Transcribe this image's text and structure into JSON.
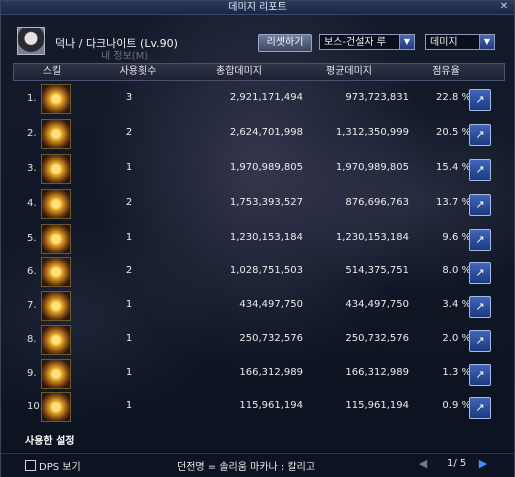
{
  "window": {
    "title": "데미지 리포트",
    "close_glyph": "✕"
  },
  "header": {
    "character": "덕나 / 다크나이트 (Lv.90)",
    "info_bar": "내 정보(M)",
    "reset_label": "리셋하기",
    "boss_select": {
      "value": "보스-건설자 루"
    },
    "type_select": {
      "value": "데미지"
    }
  },
  "columns": [
    "스킬",
    "사용횟수",
    "총합데미지",
    "평균데미지",
    "점유율"
  ],
  "rows": [
    {
      "rank": "1.",
      "count": "3",
      "total": "2,921,171,494",
      "avg": "973,723,831",
      "share": "22.8 %",
      "icon": "skill-icon"
    },
    {
      "rank": "2.",
      "count": "2",
      "total": "2,624,701,998",
      "avg": "1,312,350,999",
      "share": "20.5 %",
      "icon": "skill-icon"
    },
    {
      "rank": "3.",
      "count": "1",
      "total": "1,970,989,805",
      "avg": "1,970,989,805",
      "share": "15.4 %",
      "icon": "skill-icon"
    },
    {
      "rank": "4.",
      "count": "2",
      "total": "1,753,393,527",
      "avg": "876,696,763",
      "share": "13.7 %",
      "icon": "skill-icon"
    },
    {
      "rank": "5.",
      "count": "1",
      "total": "1,230,153,184",
      "avg": "1,230,153,184",
      "share": "9.6 %",
      "icon": "skill-icon"
    },
    {
      "rank": "6.",
      "count": "2",
      "total": "1,028,751,503",
      "avg": "514,375,751",
      "share": "8.0 %",
      "icon": "skill-icon"
    },
    {
      "rank": "7.",
      "count": "1",
      "total": "434,497,750",
      "avg": "434,497,750",
      "share": "3.4 %",
      "icon": "skill-icon"
    },
    {
      "rank": "8.",
      "count": "1",
      "total": "250,732,576",
      "avg": "250,732,576",
      "share": "2.0 %",
      "icon": "skill-icon"
    },
    {
      "rank": "9.",
      "count": "1",
      "total": "166,312,989",
      "avg": "166,312,989",
      "share": "1.3 %",
      "icon": "skill-icon"
    },
    {
      "rank": "10.",
      "count": "1",
      "total": "115,961,194",
      "avg": "115,961,194",
      "share": "0.9 %",
      "icon": "skill-icon"
    }
  ],
  "detail_glyph": "↗",
  "settings_label": "사용한 설정",
  "footer": {
    "dps_label": "DPS 보기",
    "dungeon_info": "던전명 = 솔리움 마카나 : 칼리고",
    "page": "1/ 5",
    "prev_glyph": "◀",
    "next_glyph": "▶"
  },
  "colors": {
    "accent": "#3f66b8",
    "page_next": "#3f8cff"
  }
}
